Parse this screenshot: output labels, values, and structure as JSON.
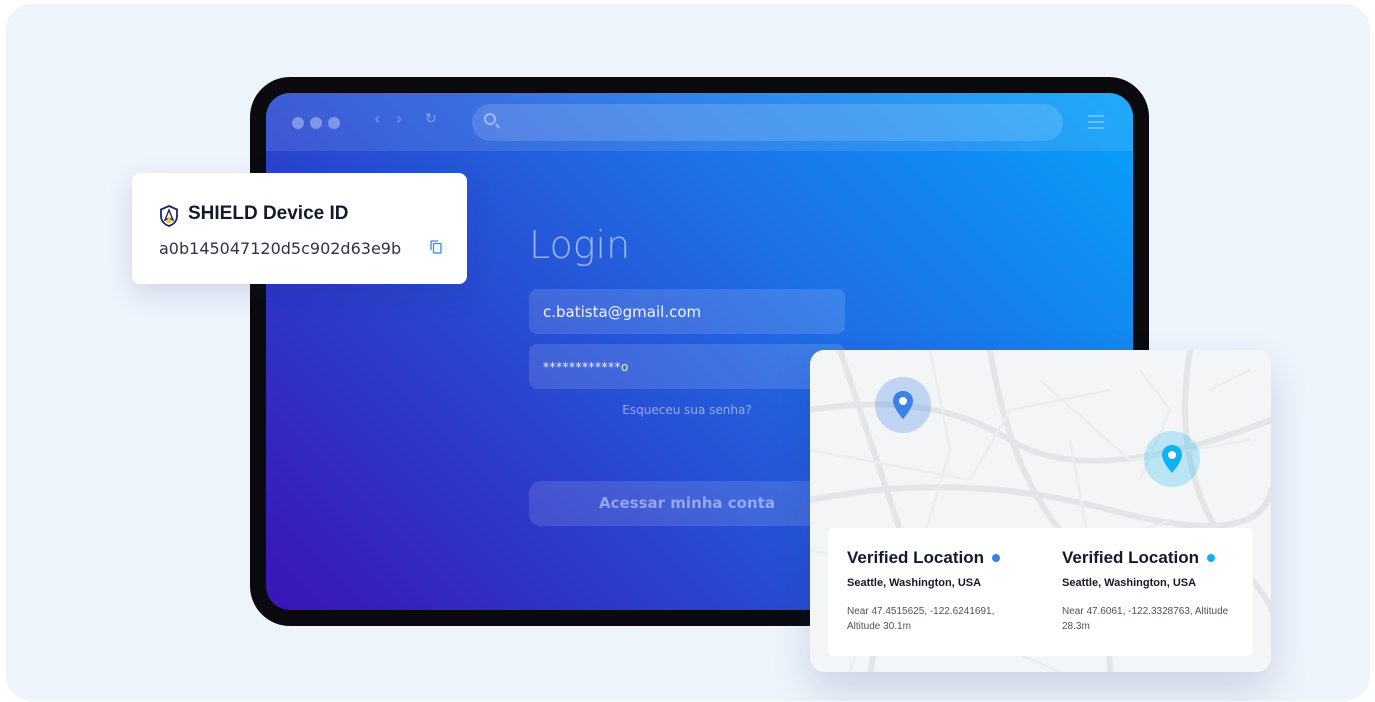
{
  "login": {
    "title": "Login",
    "email_value": "c.batista@gmail.com",
    "password_value": "************o",
    "forgot_label": "Esqueceu sua senha?",
    "submit_label": "Acessar minha conta"
  },
  "device_card": {
    "title": "SHIELD Device ID",
    "device_id": "a0b145047120d5c902d63e9b",
    "icon": "shield-icon",
    "copy_icon": "copy-icon"
  },
  "locations": [
    {
      "title": "Verified Location",
      "city": "Seattle, Washington, USA",
      "coords": "Near 47.4515625, -122.6241691, Altitude 30.1m",
      "dot_color": "#3b82e6"
    },
    {
      "title": "Verified Location",
      "city": "Seattle, Washington, USA",
      "coords": "Near 47.6061, -122.3328763, Altitude 28.3m",
      "dot_color": "#0eb2f0"
    }
  ],
  "colors": {
    "pin_a": "#3b82e6",
    "pin_b": "#0eb2f0",
    "screen_gradient_start": "#06a2fb",
    "screen_gradient_end": "#3a14b6"
  }
}
